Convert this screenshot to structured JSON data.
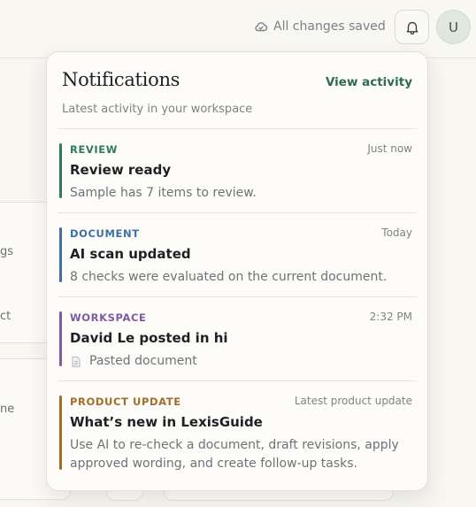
{
  "topbar": {
    "save_status": "All changes saved",
    "avatar_initial": "U"
  },
  "background": {
    "fragment_1": "gs",
    "fragment_2": "ct",
    "fragment_3": "ne"
  },
  "notifications": {
    "title": "Notifications",
    "view_activity_label": "View activity",
    "subtitle": "Latest activity in your workspace",
    "items": [
      {
        "kind": "REVIEW",
        "kind_color": "#2f7a5a",
        "time": "Just now",
        "title": "Review ready",
        "body": "Sample has 7 items to review."
      },
      {
        "kind": "DOCUMENT",
        "kind_color": "#3f6fa3",
        "time": "Today",
        "title": "AI scan updated",
        "body": "8 checks were evaluated on the current document."
      },
      {
        "kind": "WORKSPACE",
        "kind_color": "#7e5aa3",
        "time": "2:32 PM",
        "title": "David Le posted in hi",
        "body": "Pasted document"
      },
      {
        "kind": "PRODUCT UPDATE",
        "kind_color": "#a16d2b",
        "time": "Latest product update",
        "title": "What’s new in LexisGuide",
        "body": "Use AI to re-check a document, draft revisions, apply approved wording, and create follow-up tasks."
      }
    ]
  }
}
